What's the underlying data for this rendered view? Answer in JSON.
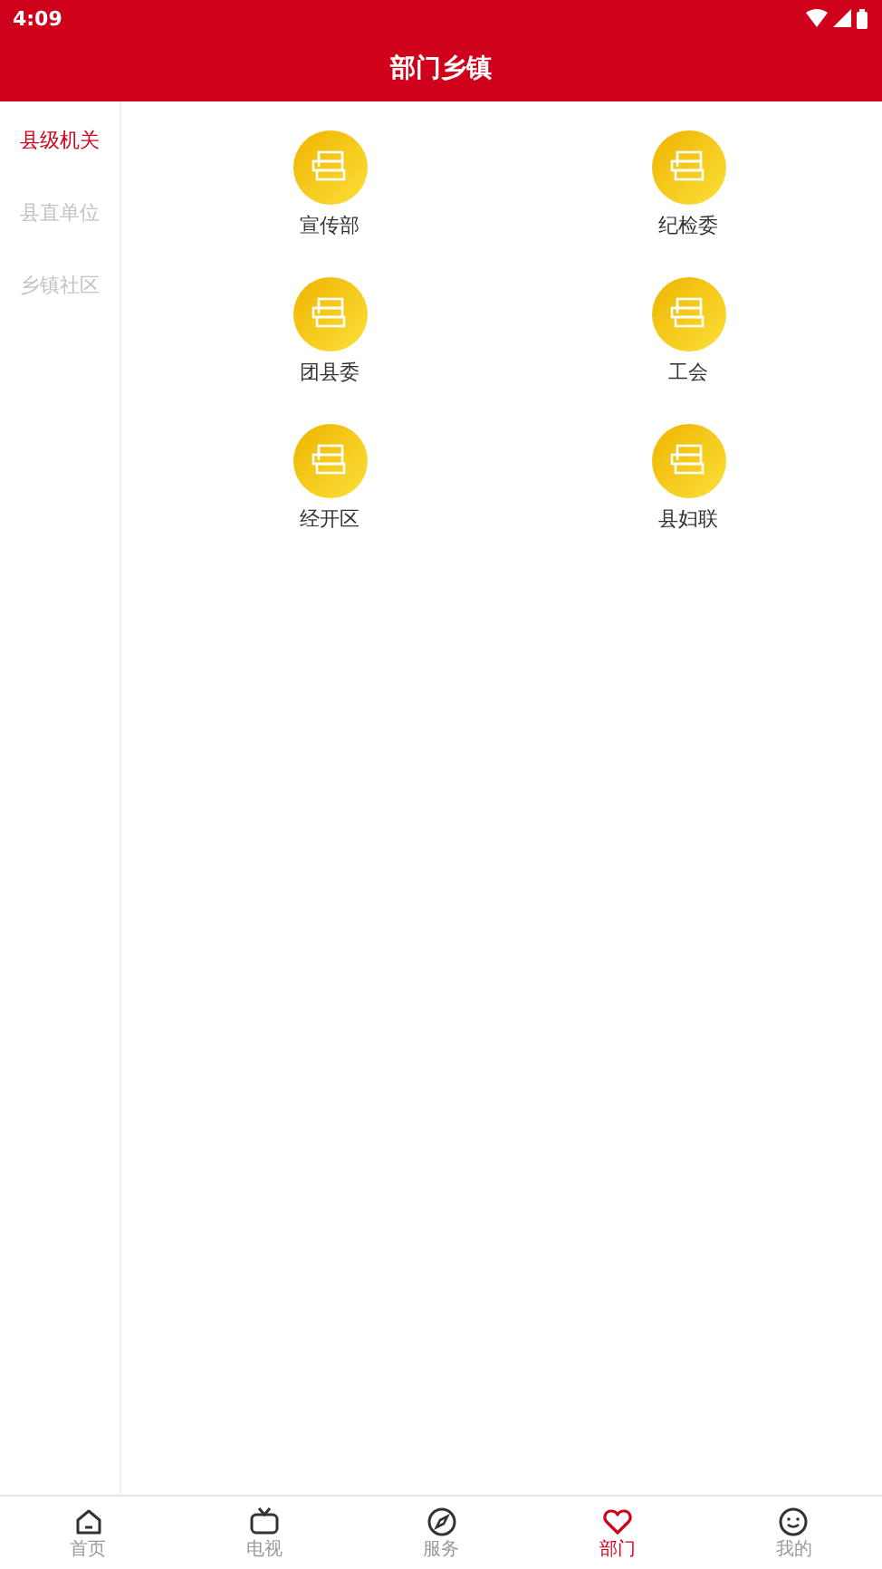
{
  "status_bar": {
    "time": "4:09"
  },
  "header": {
    "title": "部门乡镇"
  },
  "sidebar": {
    "items": [
      {
        "label": "县级机关",
        "selected": true
      },
      {
        "label": "县直单位",
        "selected": false
      },
      {
        "label": "乡镇社区",
        "selected": false
      }
    ]
  },
  "departments": [
    {
      "label": "宣传部"
    },
    {
      "label": "纪检委"
    },
    {
      "label": "团县委"
    },
    {
      "label": "工会"
    },
    {
      "label": "经开区"
    },
    {
      "label": "县妇联"
    }
  ],
  "tab_bar": {
    "items": [
      {
        "label": "首页",
        "kind": "home",
        "selected": false
      },
      {
        "label": "电视",
        "kind": "tv",
        "selected": false
      },
      {
        "label": "服务",
        "kind": "compass",
        "selected": false
      },
      {
        "label": "部门",
        "kind": "heart",
        "selected": true
      },
      {
        "label": "我的",
        "kind": "smile",
        "selected": false
      }
    ]
  }
}
